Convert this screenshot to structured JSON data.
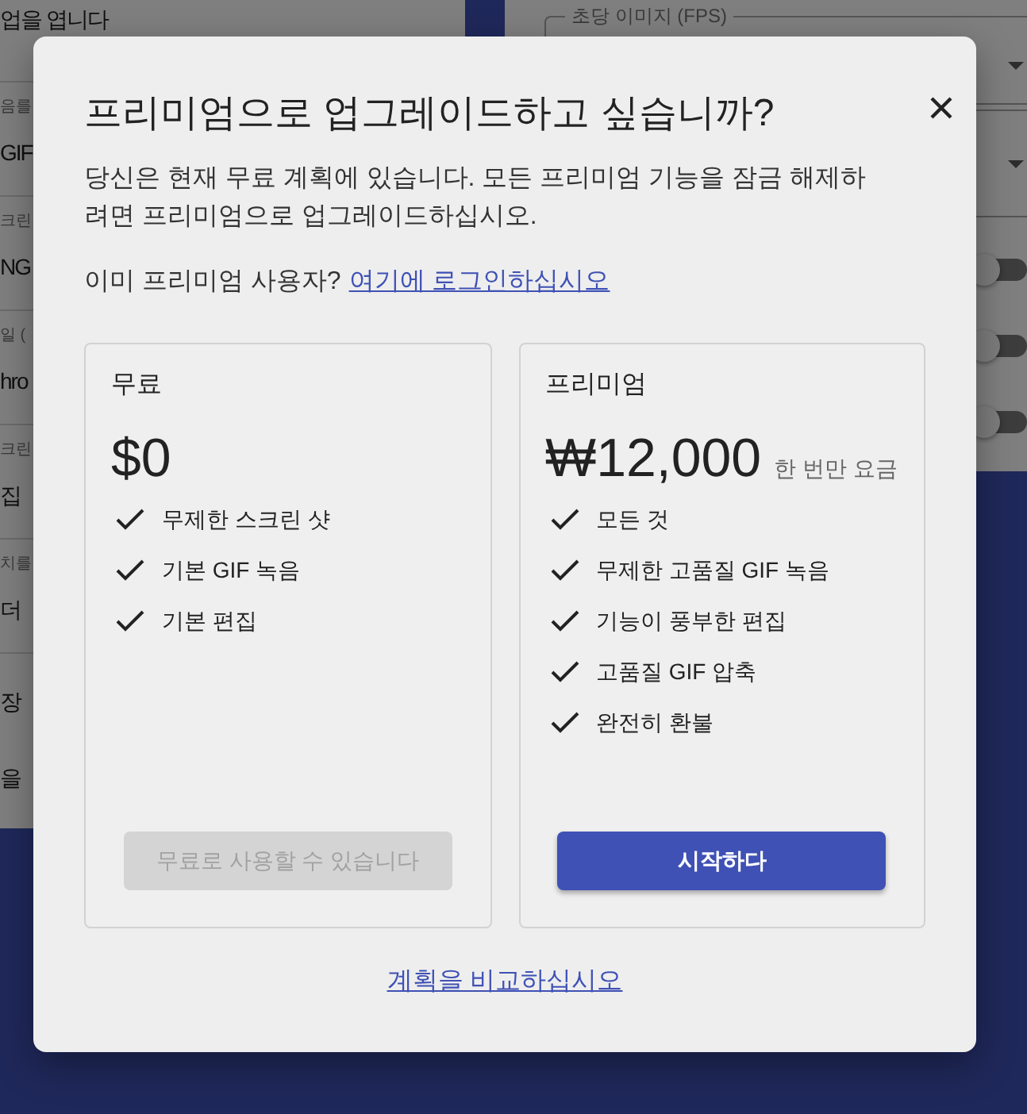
{
  "background": {
    "left_panel": {
      "items": [
        {
          "kind": "value",
          "value": "업을 엽니다"
        },
        {
          "kind": "setting",
          "label": "음를",
          "value": "GIF"
        },
        {
          "kind": "setting",
          "label": "크린",
          "value": "NG"
        },
        {
          "kind": "setting",
          "label": "일 (",
          "value": "hro"
        },
        {
          "kind": "setting",
          "label": "크린",
          "value": "집"
        },
        {
          "kind": "setting",
          "label": "치를",
          "value": "더"
        },
        {
          "kind": "option",
          "value": "장"
        },
        {
          "kind": "option",
          "value": "을"
        }
      ]
    },
    "right_panel": {
      "fields": [
        {
          "kind": "select",
          "label": "초당 이미지 (FPS)"
        },
        {
          "kind": "select"
        },
        {
          "kind": "toggle",
          "on": false
        },
        {
          "kind": "toggle",
          "on": false
        },
        {
          "kind": "toggle",
          "on": false
        }
      ]
    }
  },
  "dialog": {
    "title": "프리미엄으로 업그레이드하고 싶습니까?",
    "description": "당신은 현재 무료 계획에 있습니다. 모든 프리미엄 기능을 잠금 해제하려면 프리미엄으로 업그레이드하십시오.",
    "login_prompt": "이미 프리미엄 사용자?",
    "login_link": "여기에 로그인하십시오",
    "plans": [
      {
        "name": "무료",
        "price": "$0",
        "features": [
          "무제한 스크린 샷",
          "기본 GIF 녹음",
          "기본 편집"
        ],
        "button": {
          "label": "무료로 사용할 수 있습니다",
          "disabled": true
        }
      },
      {
        "name": "프리미엄",
        "price": "₩12,000",
        "price_note": "한 번만 요금",
        "features": [
          "모든 것",
          "무제한 고품질 GIF 녹음",
          "기능이 풍부한 편집",
          "고품질 GIF 압축",
          "완전히 환불"
        ],
        "button": {
          "label": "시작하다",
          "disabled": false
        }
      }
    ],
    "compare_link": "계획을 비교하십시오"
  }
}
